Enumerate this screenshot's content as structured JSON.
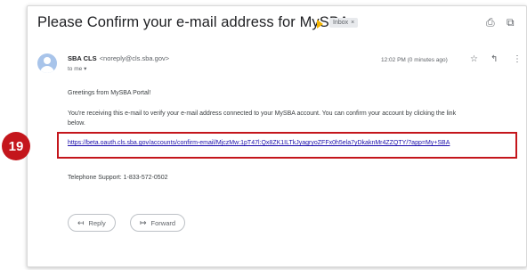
{
  "email": {
    "subject": "Please Confirm your e-mail address for MySBA",
    "label": "Inbox",
    "sender_name": "SBA CLS",
    "sender_email": "<noreply@cls.sba.gov>",
    "recipient": "to me",
    "time": "12:02 PM (0 minutes ago)",
    "greeting": "Greetings from MySBA Portal!",
    "body_line1": "You're receiving this e-mail to verify your e-mail address connected to your MySBA account. You can confirm your account by clicking the link",
    "body_line2": "below.",
    "link": "https://beta.oauth.cls.sba.gov/accounts/confirm-email/MjczMw:1pT47l:Qx8ZK1ILTkJyagryoZFFx0h5ela7yDkaknMr4ZZQTY/?app=My+SBA",
    "support": "Telephone Support: 1-833-572-0502"
  },
  "actions": {
    "reply": "Reply",
    "forward": "Forward"
  },
  "annotation": {
    "step": "19"
  }
}
